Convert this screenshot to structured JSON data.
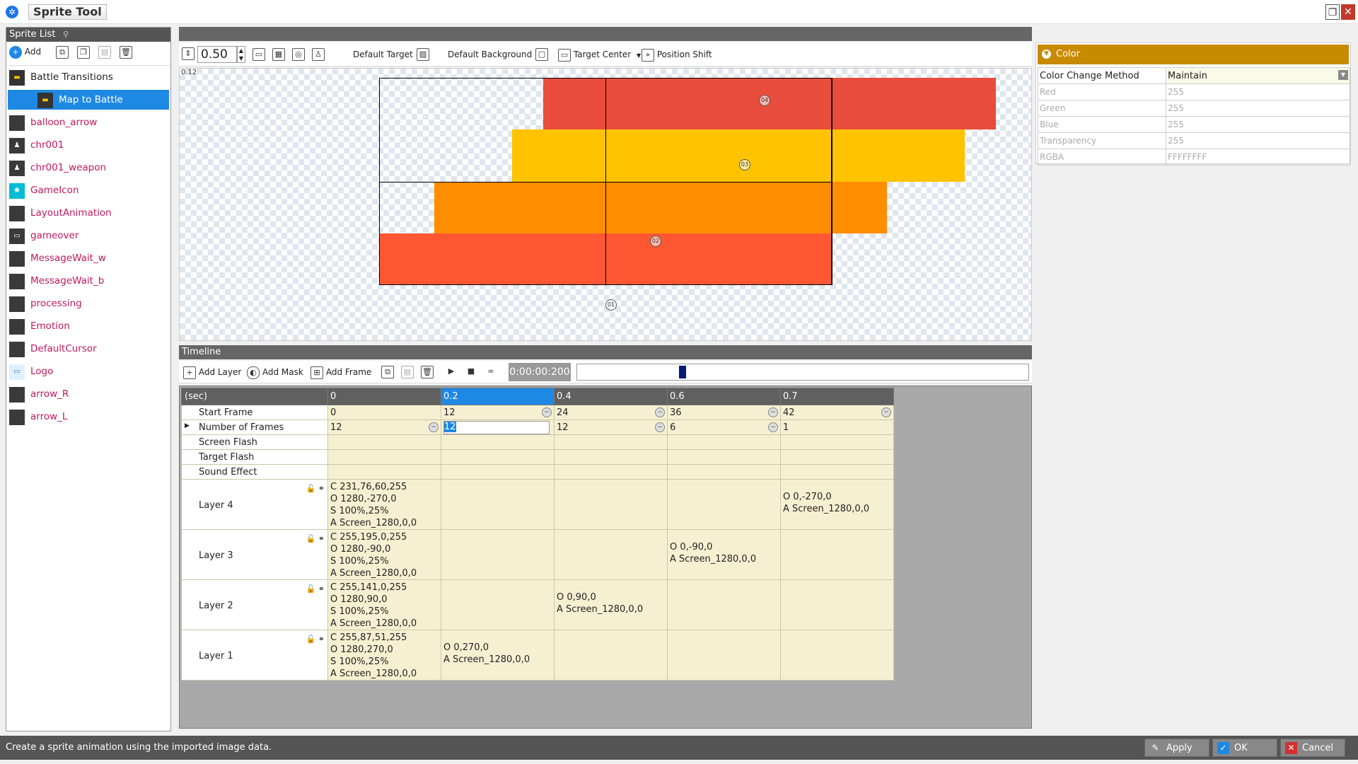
{
  "app": {
    "title": "Sprite Tool"
  },
  "sprite_list": {
    "header": "Sprite List",
    "add_label": "Add",
    "items": [
      {
        "label": "Battle Transitions"
      },
      {
        "label": "Map to Battle"
      },
      {
        "label": "balloon_arrow"
      },
      {
        "label": "chr001"
      },
      {
        "label": "chr001_weapon"
      },
      {
        "label": "GameIcon"
      },
      {
        "label": "LayoutAnimation"
      },
      {
        "label": "gameover"
      },
      {
        "label": "MessageWait_w"
      },
      {
        "label": "MessageWait_b"
      },
      {
        "label": "processing"
      },
      {
        "label": "Emotion"
      },
      {
        "label": "DefaultCursor"
      },
      {
        "label": "Logo"
      },
      {
        "label": "arrow_R"
      },
      {
        "label": "arrow_L"
      }
    ]
  },
  "preview": {
    "zoom": "0.50",
    "zoom_readout": "0.12",
    "default_target": "Default Target",
    "default_background": "Default Background",
    "target_center": "Target Center",
    "position_shift": "Position Shift",
    "markers": [
      "04",
      "03",
      "02",
      "01"
    ],
    "colors": {
      "red": "#e84c3c",
      "yellow": "#ffc300",
      "orange": "#ff8d00",
      "red2": "#ff5733"
    }
  },
  "timeline": {
    "title": "Timeline",
    "add_layer": "Add Layer",
    "add_mask": "Add Mask",
    "add_frame": "Add Frame",
    "time": "0:00:00:200",
    "playback_position": 0.23,
    "header": {
      "label": "(sec)",
      "cols": [
        "0",
        "0.2",
        "0.4",
        "0.6",
        "0.7"
      ]
    },
    "rows": {
      "start_frame": {
        "label": "Start Frame",
        "values": [
          "0",
          "12",
          "24",
          "36",
          "42"
        ]
      },
      "num_frames": {
        "label": "Number of Frames",
        "values": [
          "12",
          "12",
          "12",
          "6",
          "1"
        ]
      },
      "screen_flash": {
        "label": "Screen Flash"
      },
      "target_flash": {
        "label": "Target Flash"
      },
      "sound_effect": {
        "label": "Sound Effect"
      }
    },
    "layers": [
      {
        "label": "Layer 4",
        "cells": [
          [
            "C 231,76,60,255",
            "O 1280,-270,0",
            "S 100%,25%",
            "A Screen_1280,0,0"
          ],
          [],
          [],
          [],
          [
            "O 0,-270,0",
            "A Screen_1280,0,0"
          ]
        ]
      },
      {
        "label": "Layer 3",
        "cells": [
          [
            "C 255,195,0,255",
            "O 1280,-90,0",
            "S 100%,25%",
            "A Screen_1280,0,0"
          ],
          [],
          [],
          [
            "O 0,-90,0",
            "A Screen_1280,0,0"
          ],
          []
        ]
      },
      {
        "label": "Layer 2",
        "cells": [
          [
            "C 255,141,0,255",
            "O 1280,90,0",
            "S 100%,25%",
            "A Screen_1280,0,0"
          ],
          [],
          [
            "O 0,90,0",
            "A Screen_1280,0,0"
          ],
          [],
          []
        ]
      },
      {
        "label": "Layer 1",
        "cells": [
          [
            "C 255,87,51,255",
            "O 1280,270,0",
            "S 100%,25%",
            "A Screen_1280,0,0"
          ],
          [
            "O 0,270,0",
            "A Screen_1280,0,0"
          ],
          [],
          [],
          []
        ]
      }
    ]
  },
  "color_panel": {
    "title": "Color",
    "props": [
      {
        "k": "Color Change Method",
        "v": "Maintain"
      },
      {
        "k": "Red",
        "v": "255"
      },
      {
        "k": "Green",
        "v": "255"
      },
      {
        "k": "Blue",
        "v": "255"
      },
      {
        "k": "Transparency",
        "v": "255"
      },
      {
        "k": "RGBA",
        "v": "FFFFFFFF"
      }
    ]
  },
  "status": {
    "message": "Create a sprite animation using the imported image data.",
    "apply": "Apply",
    "ok": "OK",
    "cancel": "Cancel"
  }
}
